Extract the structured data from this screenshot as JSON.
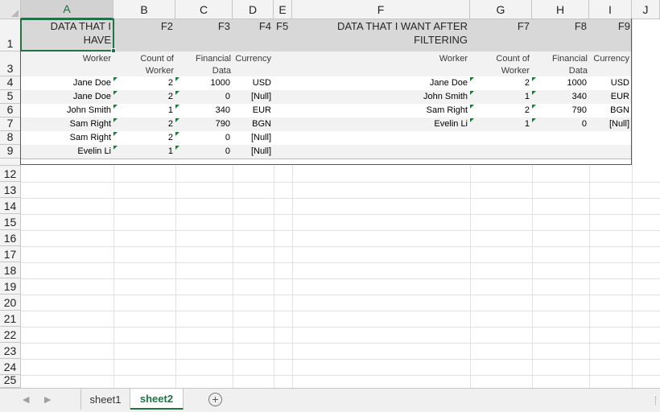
{
  "columns": [
    "A",
    "B",
    "C",
    "D",
    "E",
    "F",
    "G",
    "H",
    "I",
    "J"
  ],
  "rows": [
    "1",
    "3",
    "4",
    "5",
    "6",
    "7",
    "8",
    "9",
    "12",
    "13",
    "14",
    "15",
    "16",
    "17",
    "18",
    "19",
    "20",
    "21",
    "22",
    "23",
    "24",
    "25"
  ],
  "left_table": {
    "title": "DATA THAT I HAVE",
    "field_labels": [
      "F2",
      "F3",
      "F4",
      "F5"
    ],
    "headers": {
      "worker": "Worker",
      "count": "Count of Worker",
      "financial": "Financial Data",
      "currency": "Currency"
    },
    "rows": [
      {
        "worker": "Jane Doe",
        "count": "2",
        "financial": "1000",
        "currency": "USD"
      },
      {
        "worker": "Jane Doe",
        "count": "2",
        "financial": "0",
        "currency": "[Null]"
      },
      {
        "worker": "John Smith",
        "count": "1",
        "financial": "340",
        "currency": "EUR"
      },
      {
        "worker": "Sam Right",
        "count": "2",
        "financial": "790",
        "currency": "BGN"
      },
      {
        "worker": "Sam Right",
        "count": "2",
        "financial": "0",
        "currency": "[Null]"
      },
      {
        "worker": "Evelin Li",
        "count": "1",
        "financial": "0",
        "currency": "[Null]"
      }
    ]
  },
  "right_table": {
    "title": "DATA THAT I WANT AFTER FILTERING",
    "field_labels": [
      "F7",
      "F8",
      "F9"
    ],
    "headers": {
      "worker": "Worker",
      "count": "Count of Worker",
      "financial": "Financial Data",
      "currency": "Currency"
    },
    "rows": [
      {
        "worker": "Jane Doe",
        "count": "2",
        "financial": "1000",
        "currency": "USD"
      },
      {
        "worker": "John Smith",
        "count": "1",
        "financial": "340",
        "currency": "EUR"
      },
      {
        "worker": "Sam Right",
        "count": "2",
        "financial": "790",
        "currency": "BGN"
      },
      {
        "worker": "Evelin Li",
        "count": "1",
        "financial": "0",
        "currency": "[Null]"
      }
    ]
  },
  "sheet_tabs": [
    {
      "label": "sheet1",
      "active": false
    },
    {
      "label": "sheet2",
      "active": true
    }
  ],
  "tabbar": {
    "add_label": "+",
    "prev_icon": "◀",
    "next_icon": "▶"
  },
  "colors": {
    "accent": "#217346",
    "error_flag": "#1a7d3a",
    "title_band": "#d8d8d8",
    "alt_band": "#f2f2f2"
  }
}
